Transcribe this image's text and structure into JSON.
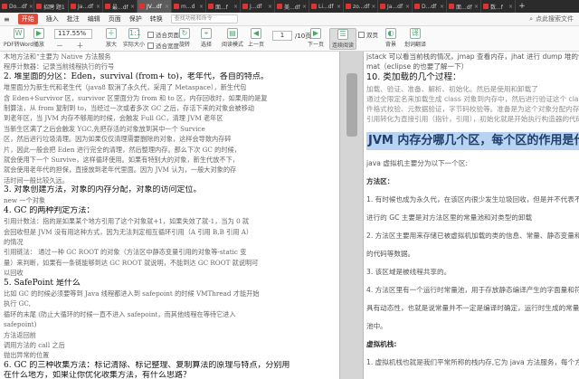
{
  "tabs": [
    {
      "label": "Do...df"
    },
    {
      "label": "招聘 题1"
    },
    {
      "label": "Ja...df"
    },
    {
      "label": "最...df"
    },
    {
      "label": "JV...df"
    },
    {
      "label": "m...d"
    },
    {
      "label": "面...f"
    },
    {
      "label": "J...df"
    },
    {
      "label": "美...df"
    },
    {
      "label": "Li...df"
    },
    {
      "label": "zo...df"
    },
    {
      "label": "Ja...df"
    },
    {
      "label": "D...df"
    },
    {
      "label": "面...df"
    },
    {
      "label": "数...f"
    }
  ],
  "active_tab_index": 4,
  "menu": {
    "start": "开始",
    "items": [
      "插入",
      "批注",
      "编辑",
      "页面",
      "保护",
      "转换"
    ],
    "search_placeholder": "查找功能和命令",
    "right_label": "点此搜索文件"
  },
  "toolbar": {
    "pdf_convert": "PDF转Word",
    "play": "播放",
    "zoom_value": "117.55%",
    "zoom_ops": "－ ＋",
    "enlarge": "放大",
    "actual_size": "实际大小",
    "fit_page": "适合页面",
    "fit_width": "适合宽度",
    "rotate": "旋转",
    "select": "选择",
    "first_page": "上一页",
    "page_current": "1",
    "page_total": "/10页",
    "next_page": "下一页",
    "continuous_read": "连续阅读",
    "double_page": "双页",
    "background": "背景",
    "translate": "划词翻译",
    "read_mode": "阅读模式"
  },
  "left_doc": {
    "lines": [
      {
        "text": "木地方法和“主要为 Native 方法服务",
        "style": "small"
      },
      {
        "text": "程序计数器：记录当前线程执行的行号",
        "style": "small"
      },
      {
        "text": "2.  堆里面的分区：Eden，survival  (from+ to)，老年代，各自的特点。",
        "style": "head"
      },
      {
        "text": "堆里面分为新生代和老生代（java8 取消了永久代，采用了 Metaspace），新生代包",
        "style": "small"
      },
      {
        "text": "含 Eden+Survivor 区，survivor 区里面分为 from 和 to 区，内存回收时，如果用的是复",
        "style": "small"
      },
      {
        "text": "制算法，从 from 复制到 to，当经过一次或者多次 GC 之后，存活下来的对象会被移动",
        "style": "small"
      },
      {
        "text": "到老年区，当 JVM 内存不够用的时候，会触发 Full GC，清理 JVM 老年区",
        "style": "small"
      },
      {
        "text": "当新生区满了之后会触发 YGC,先把存活的对象放到其中一个 Survice",
        "style": "small"
      },
      {
        "text": "区，然后进行垃圾清理。因为如果仅仅清理需要删除的对象，这样会导致内存碎",
        "style": "small"
      },
      {
        "text": "片，因此一般会把 Eden 进行完全的清理，然后整理内存。那么下次 GC 的时候，",
        "style": "small"
      },
      {
        "text": "就会使用下一个 Survive，这样循环使用。如果有特别大的对象，新生代放不下，",
        "style": "small"
      },
      {
        "text": "就会使用老年代的担保，直接放到老年代里面。因为 JVM 认为，一般大对象的存",
        "style": "small"
      },
      {
        "text": "活时间一般比较久远。",
        "style": "small"
      },
      {
        "text": "3.  对象创建方法，对象的内存分配，对象的访问定位。",
        "style": "head"
      },
      {
        "text": "new  一个对象",
        "style": "small"
      },
      {
        "text": "4.  GC 的两种判定方法：",
        "style": "head"
      },
      {
        "text": "引用计数法：指的是如果某个地方引用了这个对象就+1，如果失效了就-1，当为 0 就",
        "style": "small"
      },
      {
        "text": "会回收但是 JVM 没有用这种方式，因为无法判定相互循环引用（A 引用 B,B 引用 A）",
        "style": "small"
      },
      {
        "text": "的情况",
        "style": "small"
      },
      {
        "text": "引用链法：  通过一种 GC ROOT 的对象（方法区中静态变量引用的对象等-static 变",
        "style": "small"
      },
      {
        "text": "量）来判断，如果有一条链能够到达 GC ROOT 就说明，不能到达 GC ROOT 就说明可",
        "style": "small"
      },
      {
        "text": "以回收",
        "style": "small"
      },
      {
        "text": "5.  SafePoint 是什么",
        "style": "head"
      },
      {
        "text": "比如 GC 的时候必须要等到 Java 线程都进入到 safepoint 的时候 VMThread 才能开始",
        "style": "small"
      },
      {
        "text": "执行 GC,",
        "style": "small"
      },
      {
        "text": "循环的末尾 (防止大循环的时候一直不进入 safepoint，而其他线程在等待它进入",
        "style": "small"
      },
      {
        "text": "safepoint)",
        "style": "small"
      },
      {
        "text": "方法返回前",
        "style": "small"
      },
      {
        "text": "调用方法的 call 之后",
        "style": "small"
      },
      {
        "text": "抛出异常的位置",
        "style": "small"
      },
      {
        "text": "6.  GC 的三种收集方法：标记清除、标记整理、复制算法的原理与特点，分别用",
        "style": "head"
      },
      {
        "text": "在什么地方，如果让你优化收集方法，有什么思路？",
        "style": "head"
      },
      {
        "text": "先标记，标记完毕之后再清除，效率不高，会产生碎片",
        "style": "small"
      }
    ]
  },
  "right_doc": {
    "top_lines": [
      "jstack 可以看当前栈的情况，jmap 查看内存，jhat 进行 dump 堆的信息",
      "mat（eclipse 的也要了解一下）"
    ],
    "section_title": "10.  类加载的几个过程：",
    "section_lines": [
      "加载、验证、准备、解析、初始化。然后是使用和卸载了",
      "通过全限定名来加载生成 class 对象到内存中，然后进行验证这个 class 文件",
      "件格式校验、元数据验证，字节码校验等。准备是为这个对象分配内存。解",
      "引用转化为直接引用（指针，引用），初始化就是开始执行构造器的代码"
    ],
    "highlight_title": "JVM 内存分哪几个区，每个区的作用是什么？",
    "body": [
      {
        "text": "java 虚拟机主要分为以下一个区:",
        "kind": "normal"
      },
      {
        "text": "方法区：",
        "kind": "bold"
      },
      {
        "text": "1. 有时候也成为永久代，在该区内很少发生垃圾回收，但是并不代表不发生",
        "kind": "normal"
      },
      {
        "text": "进行的 GC 主要是对方法区里的常量池和对类型的卸载",
        "kind": "normal"
      },
      {
        "text": "2. 方法区主要用来存储已被虚拟机加载的类的信息、常量、静态变量和即时",
        "kind": "normal"
      },
      {
        "text": "的代码等数据。",
        "kind": "normal"
      },
      {
        "text": "3. 该区域是被线程共享的。",
        "kind": "normal"
      },
      {
        "text": "4. 方法区里有一个运行时常量池，用于存放静态编译产生的字面量和符号引",
        "kind": "normal"
      },
      {
        "text": "具有动态性，也就是说常量并不一定是编译时确定，运行时生成的常量也会",
        "kind": "normal"
      },
      {
        "text": "池中。",
        "kind": "normal"
      },
      {
        "text": "虚拟机栈:",
        "kind": "bold"
      },
      {
        "text": "1. 虚拟机栈也就是我们平常所称的栈内存,它为 java 方法服务，每个方法在",
        "kind": "normal"
      }
    ]
  },
  "colors": {
    "accent": "#e14b3b",
    "highlight": "#b9d3f2",
    "title_text": "#1f3e6b",
    "link_blue": "#3a6bc9"
  }
}
